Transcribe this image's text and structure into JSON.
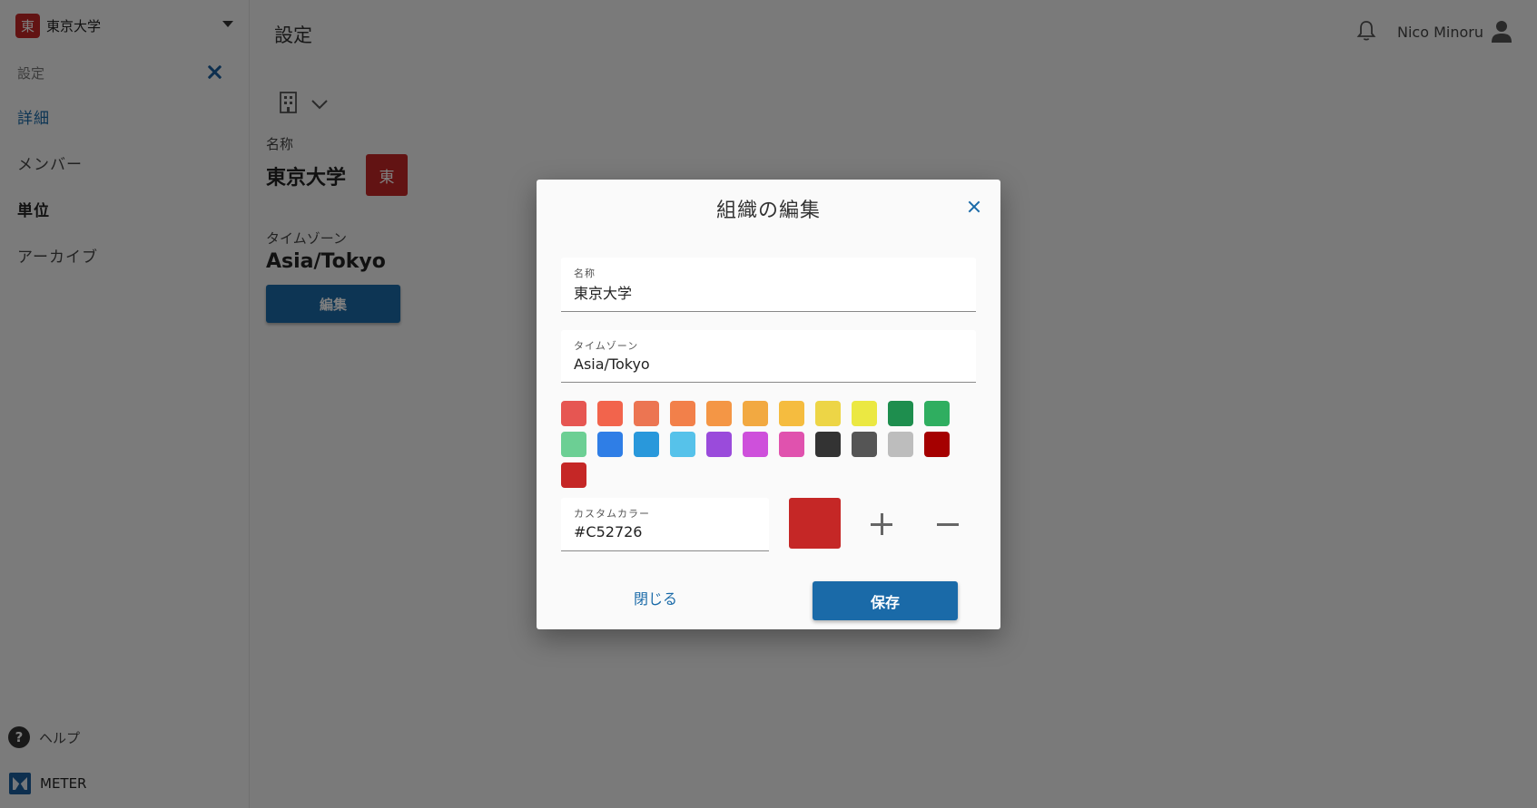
{
  "sidebar": {
    "org_initial": "東",
    "org_name": "東京大学",
    "section_title": "設定",
    "nav": [
      {
        "label": "詳細"
      },
      {
        "label": "メンバー"
      },
      {
        "label": "単位"
      },
      {
        "label": "アーカイブ"
      }
    ],
    "help_label": "ヘルプ",
    "brand_label": "METER"
  },
  "header": {
    "title": "設定",
    "user_name": "Nico Minoru"
  },
  "main": {
    "name_label": "名称",
    "name_value": "東京大学",
    "badge_initial": "東",
    "timezone_label": "タイムゾーン",
    "timezone_value": "Asia/Tokyo",
    "edit_label": "編集"
  },
  "dialog": {
    "title": "組織の編集",
    "name_field": {
      "label": "名称",
      "value": "東京大学"
    },
    "timezone_field": {
      "label": "タイムゾーン",
      "value": "Asia/Tokyo"
    },
    "palette": [
      "#E65652",
      "#F2644C",
      "#EC7552",
      "#F2804A",
      "#F49645",
      "#F2A941",
      "#F5BC3F",
      "#EDD546",
      "#EBE842",
      "#1E8E4E",
      "#2FAE60",
      "#6CCF94",
      "#2F7EE6",
      "#2998DB",
      "#56C2EA",
      "#9A4BDB",
      "#CE50DB",
      "#E052AE",
      "#333333",
      "#555555",
      "#BDBDBD",
      "#A50000",
      "#C52726"
    ],
    "custom_color_field": {
      "label": "カスタムカラー",
      "value": "#C52726"
    },
    "preview_color": "#C52726",
    "close_label": "閉じる",
    "save_label": "保存"
  }
}
